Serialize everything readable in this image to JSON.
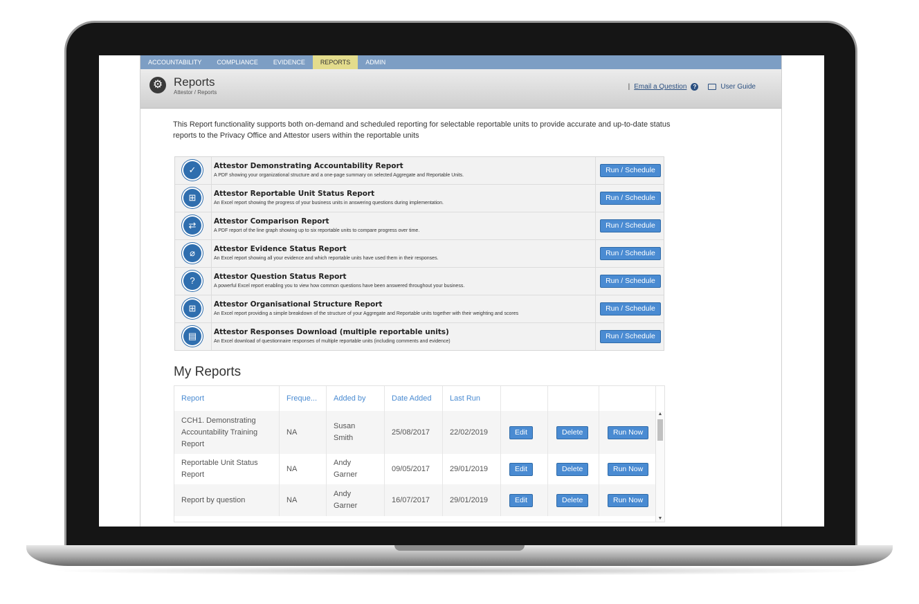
{
  "nav": {
    "items": [
      {
        "label": "ACCOUNTABILITY",
        "active": false
      },
      {
        "label": "COMPLIANCE",
        "active": false
      },
      {
        "label": "EVIDENCE",
        "active": false
      },
      {
        "label": "REPORTS",
        "active": true
      },
      {
        "label": "ADMIN",
        "active": false
      }
    ]
  },
  "header": {
    "icon": "gear-icon",
    "title": "Reports",
    "breadcrumb": "Attestor / Reports",
    "separator": "|",
    "email_link": "Email a Question",
    "help_icon": "?",
    "user_guide": "User Guide"
  },
  "intro": "This Report functionality supports both on-demand and scheduled reporting for selectable reportable units to provide accurate and up-to-date status reports to the Privacy Office and Attestor users within the reportable units",
  "reports": [
    {
      "title": "Attestor Demonstrating Accountability Report",
      "desc": "A PDF showing your organizational structure and a one-page summary on selected Aggregate and Reportable Units.",
      "icon": "checkmark-icon",
      "button": "Run / Schedule"
    },
    {
      "title": "Attestor Reportable Unit Status Report",
      "desc": "An Excel report showing the progress of your business units in answering questions during implementation.",
      "icon": "org-chart-icon",
      "button": "Run / Schedule"
    },
    {
      "title": "Attestor Comparison Report",
      "desc": "A PDF report of the line graph showing up to six reportable units to compare progress over time.",
      "icon": "compare-arrows-icon",
      "button": "Run / Schedule"
    },
    {
      "title": "Attestor Evidence Status Report",
      "desc": "An Excel report showing all your evidence and which reportable units have used them in their responses.",
      "icon": "paperclip-icon",
      "button": "Run / Schedule"
    },
    {
      "title": "Attestor Question Status Report",
      "desc": "A powerful Excel report enabling you to view how common questions have been answered throughout your business.",
      "icon": "question-icon",
      "button": "Run / Schedule"
    },
    {
      "title": "Attestor Organisational Structure Report",
      "desc": "An Excel report providing a simple breakdown of the structure of your Aggregate and Reportable units together with their weighting and scores",
      "icon": "org-chart-icon",
      "button": "Run / Schedule"
    },
    {
      "title": "Attestor Responses Download (multiple reportable units)",
      "desc": "An Excel download of questionnaire responses of multiple reportable units (including comments and evidence)",
      "icon": "document-icon",
      "button": "Run / Schedule"
    }
  ],
  "my_reports": {
    "title": "My Reports",
    "columns": [
      "Report",
      "Freque...",
      "Added by",
      "Date Added",
      "Last Run",
      "",
      "",
      ""
    ],
    "rows": [
      {
        "report": "CCH1. Demonstrating Accountability Training Report",
        "freq": "NA",
        "added_by": "Susan Smith",
        "date_added": "25/08/2017",
        "last_run": "22/02/2019",
        "edit": "Edit",
        "delete": "Delete",
        "run": "Run Now"
      },
      {
        "report": "Reportable Unit Status Report",
        "freq": "NA",
        "added_by": "Andy Garner",
        "date_added": "09/05/2017",
        "last_run": "29/01/2019",
        "edit": "Edit",
        "delete": "Delete",
        "run": "Run Now"
      },
      {
        "report": "Report by question",
        "freq": "NA",
        "added_by": "Andy Garner",
        "date_added": "16/07/2017",
        "last_run": "29/01/2019",
        "edit": "Edit",
        "delete": "Delete",
        "run": "Run Now"
      }
    ]
  },
  "colors": {
    "nav_bg": "#7d9ec4",
    "nav_active": "#e3dc8c",
    "button": "#4a8bd2",
    "icon_circle": "#2f6eae",
    "link": "#2a4f80"
  }
}
